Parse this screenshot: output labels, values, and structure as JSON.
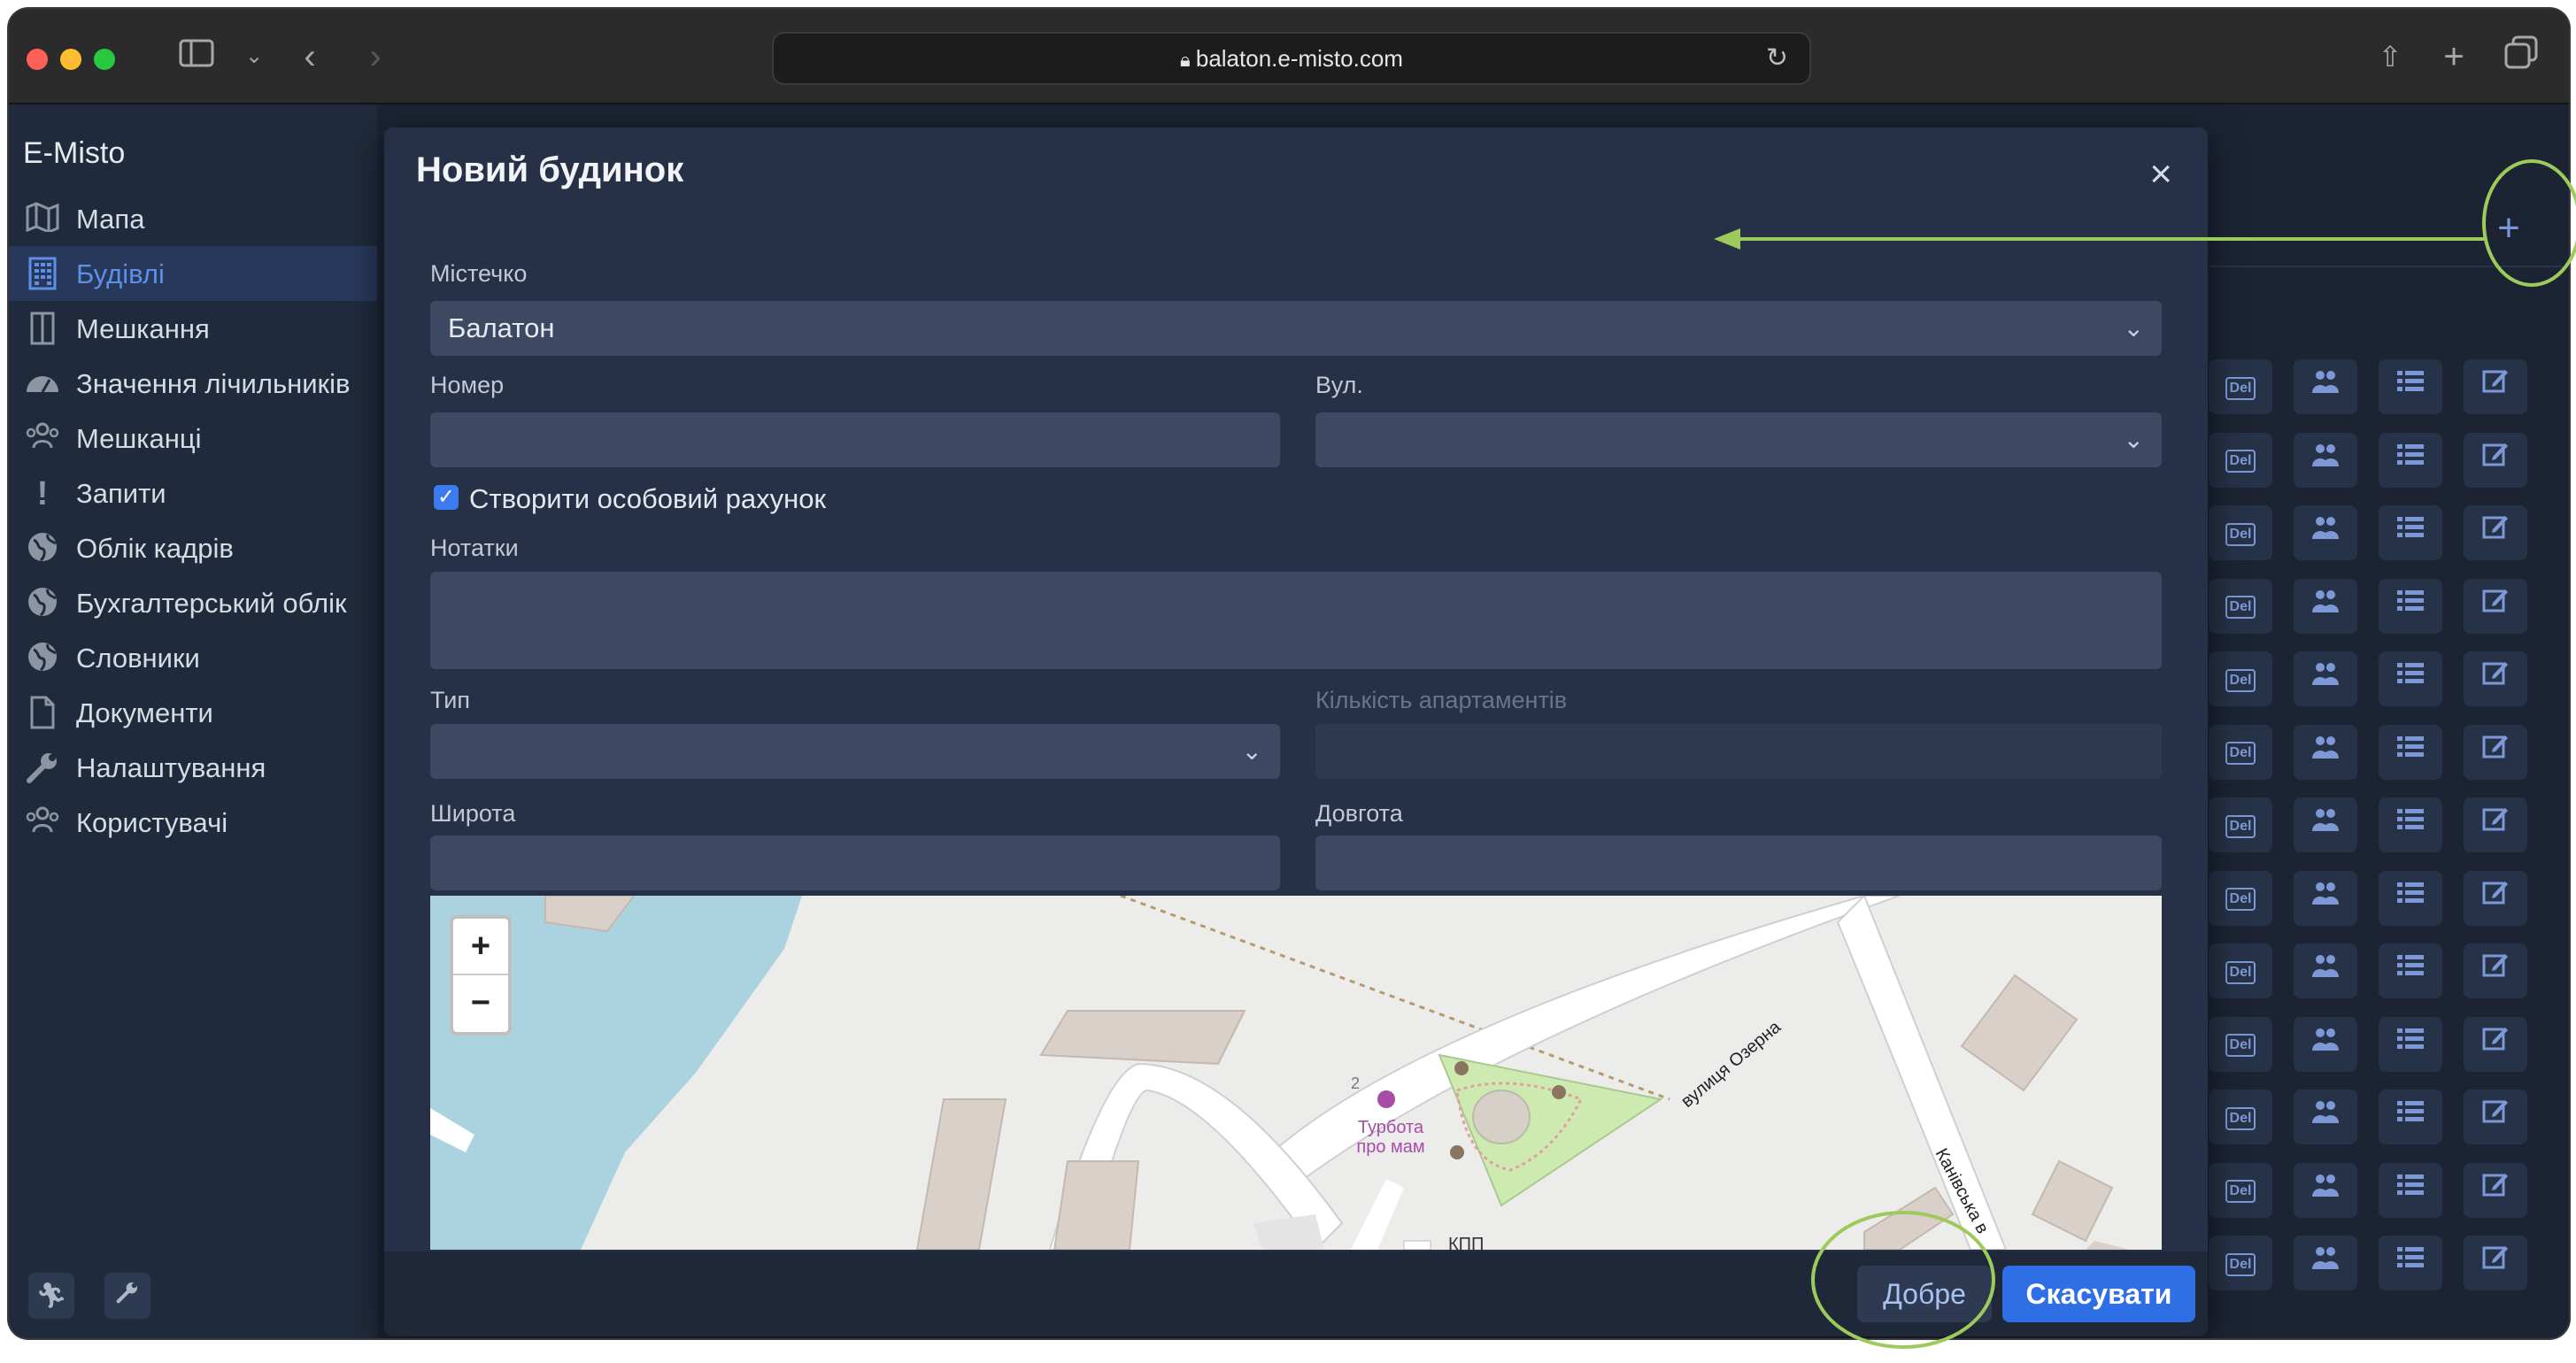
{
  "browser": {
    "url": "balaton.e-misto.com",
    "traffic_lights": [
      "#ff5f57",
      "#febc2e",
      "#28c840"
    ]
  },
  "sidebar": {
    "brand": "E-Misto",
    "items": [
      {
        "label": "Мапа",
        "icon": "map-icon",
        "active": false
      },
      {
        "label": "Будівлі",
        "icon": "building-icon",
        "active": true
      },
      {
        "label": "Мешкання",
        "icon": "door-icon",
        "active": false
      },
      {
        "label": "Значення лічильників",
        "icon": "gauge-icon",
        "active": false
      },
      {
        "label": "Мешканці",
        "icon": "people-icon",
        "active": false
      },
      {
        "label": "Запити",
        "icon": "exclamation-icon",
        "active": false
      },
      {
        "label": "Облік кадрів",
        "icon": "globe-icon",
        "active": false
      },
      {
        "label": "Бухгалтерський облік",
        "icon": "globe-icon",
        "active": false
      },
      {
        "label": "Словники",
        "icon": "globe-icon",
        "active": false
      },
      {
        "label": "Документи",
        "icon": "document-icon",
        "active": false
      },
      {
        "label": "Налаштування",
        "icon": "wrench-icon",
        "active": false
      },
      {
        "label": "Користувачі",
        "icon": "users-icon",
        "active": false
      }
    ]
  },
  "table": {
    "add_button": "+",
    "row_actions": [
      "Del",
      "people-icon",
      "list-icon",
      "edit-icon"
    ],
    "row_count": 13
  },
  "modal": {
    "title": "Новий будинок",
    "close": "×",
    "fields": {
      "town": {
        "label": "Містечко",
        "value": "Балатон"
      },
      "number": {
        "label": "Номер",
        "value": ""
      },
      "street": {
        "label": "Вул.",
        "value": ""
      },
      "create_account": {
        "label": "Створити особовий рахунок",
        "checked": true
      },
      "notes": {
        "label": "Нотатки",
        "value": ""
      },
      "type": {
        "label": "Тип",
        "value": ""
      },
      "apartments": {
        "label": "Кількість апартаментів",
        "value": ""
      },
      "latitude": {
        "label": "Широта",
        "value": ""
      },
      "longitude": {
        "label": "Довгота",
        "value": ""
      }
    },
    "map": {
      "zoom_in": "+",
      "zoom_out": "−",
      "labels": {
        "poi": "Турбота про мам",
        "poi_line1": "Турбота",
        "poi_line2": "про мам",
        "street1": "вулиця Озерна",
        "street2": "Канівська в",
        "kpp": "КПП",
        "building_no": "2"
      }
    },
    "ok": "Добре",
    "cancel": "Скасувати"
  },
  "colors": {
    "accent": "#2f6fe6",
    "annotation": "#9ccb5c"
  }
}
